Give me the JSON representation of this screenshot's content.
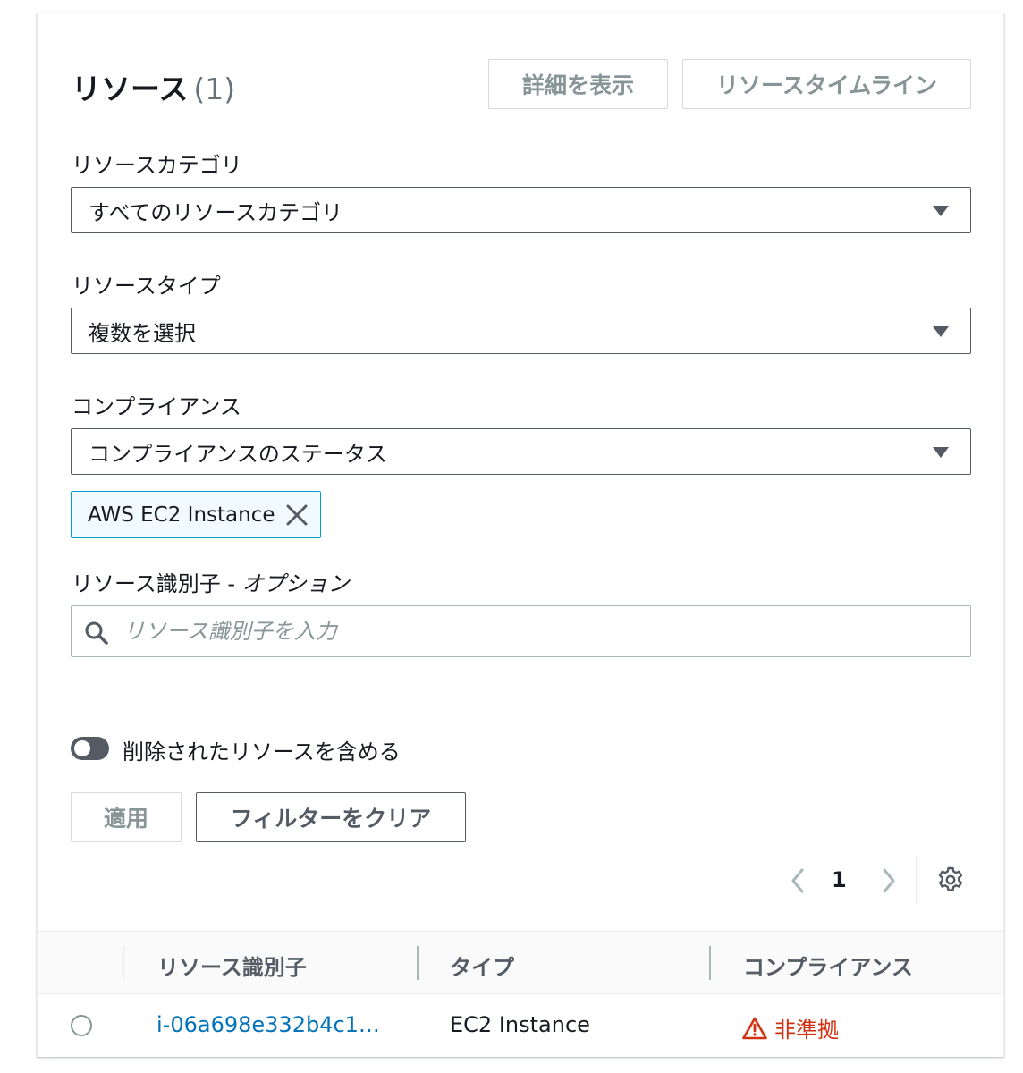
{
  "header": {
    "title": "リソース",
    "count": "(1)",
    "details_button": "詳細を表示",
    "timeline_button": "リソースタイムライン"
  },
  "filters": {
    "category": {
      "label": "リソースカテゴリ",
      "selected": "すべてのリソースカテゴリ"
    },
    "type": {
      "label": "リソースタイプ",
      "selected": "複数を選択",
      "tokens": [
        "AWS EC2 Instance"
      ]
    },
    "compliance": {
      "label": "コンプライアンス",
      "selected": "コンプライアンスのステータス"
    },
    "identifier": {
      "label_main": "リソース識別子 - ",
      "label_optional": "オプション",
      "placeholder": "リソース識別子を入力",
      "value": ""
    },
    "include_deleted": {
      "label": "削除されたリソースを含める",
      "enabled": false
    },
    "apply_button": "適用",
    "clear_button": "フィルターをクリア"
  },
  "pagination": {
    "prev": "‹",
    "page": "1",
    "next": "›"
  },
  "table": {
    "columns": [
      "リソース識別子",
      "タイプ",
      "コンプライアンス"
    ],
    "rows": [
      {
        "id": "i-06a698e332b4c1…",
        "type": "EC2 Instance",
        "compliance": "非準拠"
      }
    ]
  },
  "colors": {
    "link": "#0073bb",
    "noncompliant": "#d13212",
    "token_border": "#00a1c9"
  }
}
